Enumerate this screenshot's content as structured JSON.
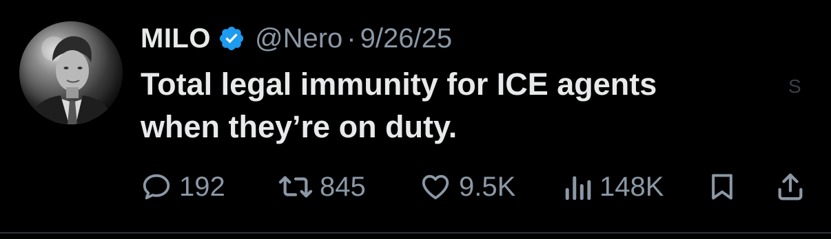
{
  "post": {
    "author_name": "MILO",
    "handle": "@Nero",
    "separator": "·",
    "date": "9/26/25",
    "text_line1": "Total legal immunity for ICE agents",
    "text_line2": "when they’re on duty.",
    "side_glyph": "S"
  },
  "actions": {
    "reply": {
      "icon": "reply-icon",
      "count": "192"
    },
    "retweet": {
      "icon": "retweet-icon",
      "count": "845"
    },
    "like": {
      "icon": "heart-icon",
      "count": "9.5K"
    },
    "views": {
      "icon": "views-icon",
      "count": "148K"
    },
    "bookmark": {
      "icon": "bookmark-icon"
    },
    "share": {
      "icon": "share-icon"
    }
  },
  "colors": {
    "background": "#000000",
    "primary_text": "#e7e9ea",
    "secondary_text": "#8b98a5",
    "verified_badge": "#1d9bf0"
  }
}
